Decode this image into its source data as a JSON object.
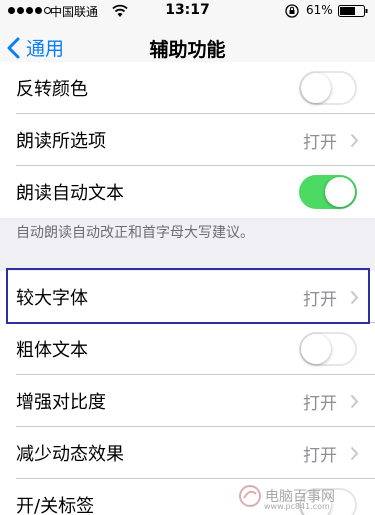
{
  "status_bar": {
    "carrier": "中国联通",
    "time": "13:17",
    "battery": "61%"
  },
  "nav": {
    "back_label": "通用",
    "title": "辅助功能"
  },
  "group1": [
    {
      "label": "反转颜色",
      "type": "toggle",
      "on": false
    },
    {
      "label": "朗读所选项",
      "type": "link",
      "value": "打开"
    },
    {
      "label": "朗读自动文本",
      "type": "toggle",
      "on": true
    }
  ],
  "group1_footer": "自动朗读自动改正和首字母大写建议。",
  "group2": [
    {
      "label": "较大字体",
      "type": "link",
      "value": "打开"
    },
    {
      "label": "粗体文本",
      "type": "toggle",
      "on": false
    },
    {
      "label": "增强对比度",
      "type": "link",
      "value": "打开"
    },
    {
      "label": "减少动态效果",
      "type": "link",
      "value": "打开"
    },
    {
      "label": "开/关标签",
      "type": "toggle",
      "on": false
    }
  ],
  "watermark": {
    "text": "电脑百事网",
    "sub": "www.pc841.com"
  },
  "colors": {
    "accent": "#0a7ff5",
    "toggle_on": "#4cd964",
    "highlight": "#2b2fa0"
  }
}
